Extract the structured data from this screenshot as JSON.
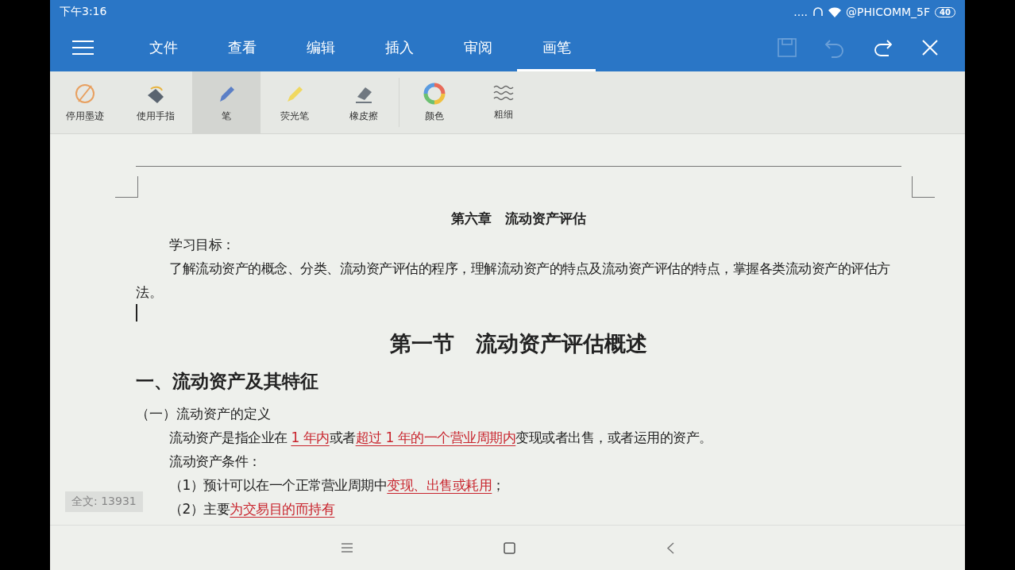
{
  "status_bar": {
    "time": "下午3:16",
    "signal": "....",
    "network": "@PHICOMM_5F",
    "battery": "40"
  },
  "menu_tabs": [
    {
      "label": "文件",
      "selected": false
    },
    {
      "label": "查看",
      "selected": false
    },
    {
      "label": "编辑",
      "selected": false
    },
    {
      "label": "插入",
      "selected": false
    },
    {
      "label": "审阅",
      "selected": false
    },
    {
      "label": "画笔",
      "selected": true
    }
  ],
  "title_actions": [
    {
      "kind": "save",
      "disabled": true
    },
    {
      "kind": "undo",
      "disabled": true
    },
    {
      "kind": "redo",
      "disabled": false
    },
    {
      "kind": "close",
      "disabled": false
    }
  ],
  "tools": [
    {
      "kind": "disable-ink",
      "label": "停用墨迹",
      "selected": false
    },
    {
      "kind": "finger",
      "label": "使用手指",
      "selected": false
    },
    {
      "kind": "pen",
      "label": "笔",
      "selected": true
    },
    {
      "kind": "highlighter",
      "label": "荧光笔",
      "selected": false
    },
    {
      "kind": "eraser",
      "label": "橡皮擦",
      "selected": false
    },
    {
      "kind": "color",
      "label": "颜色",
      "selected": false
    },
    {
      "kind": "thickness",
      "label": "粗细",
      "selected": false
    }
  ],
  "document": {
    "paragraphs": [
      {
        "kind": "chapter",
        "segments": [
          {
            "text": "第六章　流动资产评估",
            "marked": false
          }
        ]
      },
      {
        "kind": "indent",
        "segments": [
          {
            "text": "学习目标：",
            "marked": false
          }
        ]
      },
      {
        "kind": "indent",
        "segments": [
          {
            "text": "了解流动资产的概念、分类、流动资产评估的程序，理解流动资产的特点及流动资产评估的特点，掌握各类流动资产的评估方法。",
            "marked": false
          }
        ]
      },
      {
        "kind": "cursor"
      },
      {
        "kind": "section",
        "segments": [
          {
            "text": "第一节　流动资产评估概述",
            "marked": false
          }
        ]
      },
      {
        "kind": "heading",
        "segments": [
          {
            "text": "一、流动资产及其特征",
            "marked": false
          }
        ]
      },
      {
        "kind": "plain",
        "segments": [
          {
            "text": "（一）流动资产的定义",
            "marked": false
          }
        ]
      },
      {
        "kind": "indent",
        "segments": [
          {
            "text": "流动资产是指企业在 ",
            "marked": false
          },
          {
            "text": "1 年内",
            "marked": true
          },
          {
            "text": "或者",
            "marked": false
          },
          {
            "text": "超过 1 年的一个营业周期内",
            "marked": true
          },
          {
            "text": "变现或者出售，或者运用的资产。",
            "marked": false
          }
        ]
      },
      {
        "kind": "indent",
        "segments": [
          {
            "text": "流动资产条件：",
            "marked": false
          }
        ]
      },
      {
        "kind": "indent",
        "segments": [
          {
            "text": "（1）预计可以在一个正常营业周期中",
            "marked": false
          },
          {
            "text": "变现、出售或耗用",
            "marked": true
          },
          {
            "text": "；",
            "marked": false
          }
        ]
      },
      {
        "kind": "indent",
        "segments": [
          {
            "text": "（2）主要",
            "marked": false
          },
          {
            "text": "为交易目的而持有",
            "marked": true
          }
        ]
      }
    ]
  },
  "word_count": "全文: 13931"
}
